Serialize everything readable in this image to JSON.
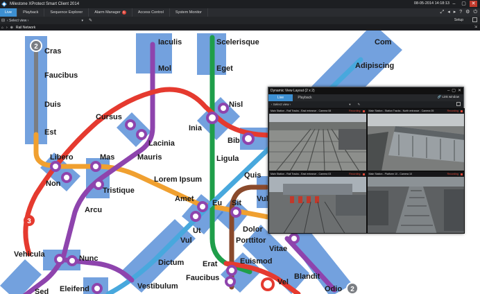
{
  "app": {
    "title": "Milestone XProtect Smart Client 2014",
    "datetime": "08-05-2014 14:18:13",
    "window_buttons": [
      "–",
      "▢",
      "✕"
    ]
  },
  "tabs": [
    {
      "label": "Live",
      "active": true
    },
    {
      "label": "Playback",
      "active": false
    },
    {
      "label": "Sequence Explorer",
      "active": false
    },
    {
      "label": "Alarm Manager",
      "active": false,
      "badge": "1"
    },
    {
      "label": "Access Control",
      "active": false
    },
    {
      "label": "System Monitor",
      "active": false
    }
  ],
  "toolbar": {
    "view_select": "‹ Select view ›",
    "setup": "Setup"
  },
  "breadcrumb": {
    "path": "Rail Network"
  },
  "map": {
    "labels": {
      "cras": "Cras",
      "faucibus1": "Faucibus",
      "duis": "Duis",
      "est": "Est",
      "iaculis": "Iaculis",
      "mol": "Mol",
      "scelerisque": "Scelerisque",
      "eget": "Eget",
      "com": "Com",
      "adipiscing": "Adipiscing",
      "nisl": "Nisl",
      "inia": "Inia",
      "cursus": "Cursus",
      "lacinia": "Lacinia",
      "mauris": "Mauris",
      "bib": "Bib",
      "ligula": "Ligula",
      "libero": "Libero",
      "mas": "Mas",
      "non": "Non",
      "tristique": "Tristique",
      "lorem": "Lorem Ipsum",
      "quis": "Quis",
      "vulpu": "Vulpu",
      "amet": "Amet",
      "eu": "Eu",
      "sit": "Sit",
      "arcu": "Arcu",
      "ut": "Ut",
      "dolor": "Dolor",
      "vul": "Vul",
      "porttitor": "Porttitor",
      "vitae": "Vitae",
      "vehicula": "Vehicula",
      "nunc": "Nunc",
      "dictum": "Dictum",
      "erat": "Erat",
      "euismod": "Euismod",
      "faucibus2": "Faucibus",
      "blandit": "Blandit",
      "vel": "Vel",
      "sed": "Sed",
      "eleifend": "Eleifend",
      "vestibulum": "Vestibulum",
      "odio": "Odio"
    },
    "line_badges": {
      "line2": "2",
      "line3": "3",
      "line2b": "2"
    },
    "colors": {
      "red": "#e53a2f",
      "purple": "#8e44ad",
      "green": "#1f9e4a",
      "orange": "#f0a030",
      "lightblue": "#48a8dd",
      "brown": "#8a4a2c",
      "gray": "#7a7d82",
      "zone": "#3d7dd1"
    }
  },
  "dynamic_window": {
    "title": "Dynamic View Layout (2 x 2)",
    "tabs": [
      "Live",
      "Playback"
    ],
    "link_window": "Link window",
    "view_select": "‹ Select view ›",
    "cameras": [
      {
        "name": "Main Station - Rail Tracks - East entrance - Camera 08",
        "status": "Recording"
      },
      {
        "name": "Main Station - Station Tracks - North entrance - Camera 05",
        "status": "Recording"
      },
      {
        "name": "Main Station - Rail Tracks - East entrance - Camera 03",
        "status": "Recording"
      },
      {
        "name": "Main Station - Platform 10 - Camera 10",
        "status": "Recording"
      }
    ]
  }
}
